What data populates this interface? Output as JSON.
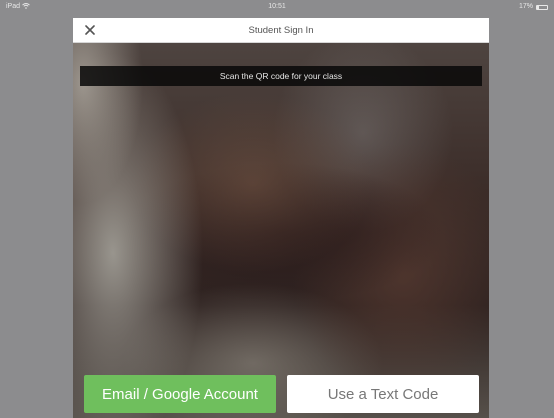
{
  "status_bar": {
    "device": "iPad",
    "wifi_icon": "wifi-icon",
    "time": "10:51",
    "battery_percent": "17%",
    "battery_level": 0.17
  },
  "modal": {
    "title": "Student Sign In",
    "close_icon": "close-icon",
    "camera_banner": "Scan the QR code for your class",
    "buttons": {
      "email_label": "Email / Google Account",
      "text_code_label": "Use a Text Code"
    }
  },
  "colors": {
    "email_button": "#6fbf5d",
    "text_code_button": "#ffffff",
    "background": "#8c8c8e"
  }
}
